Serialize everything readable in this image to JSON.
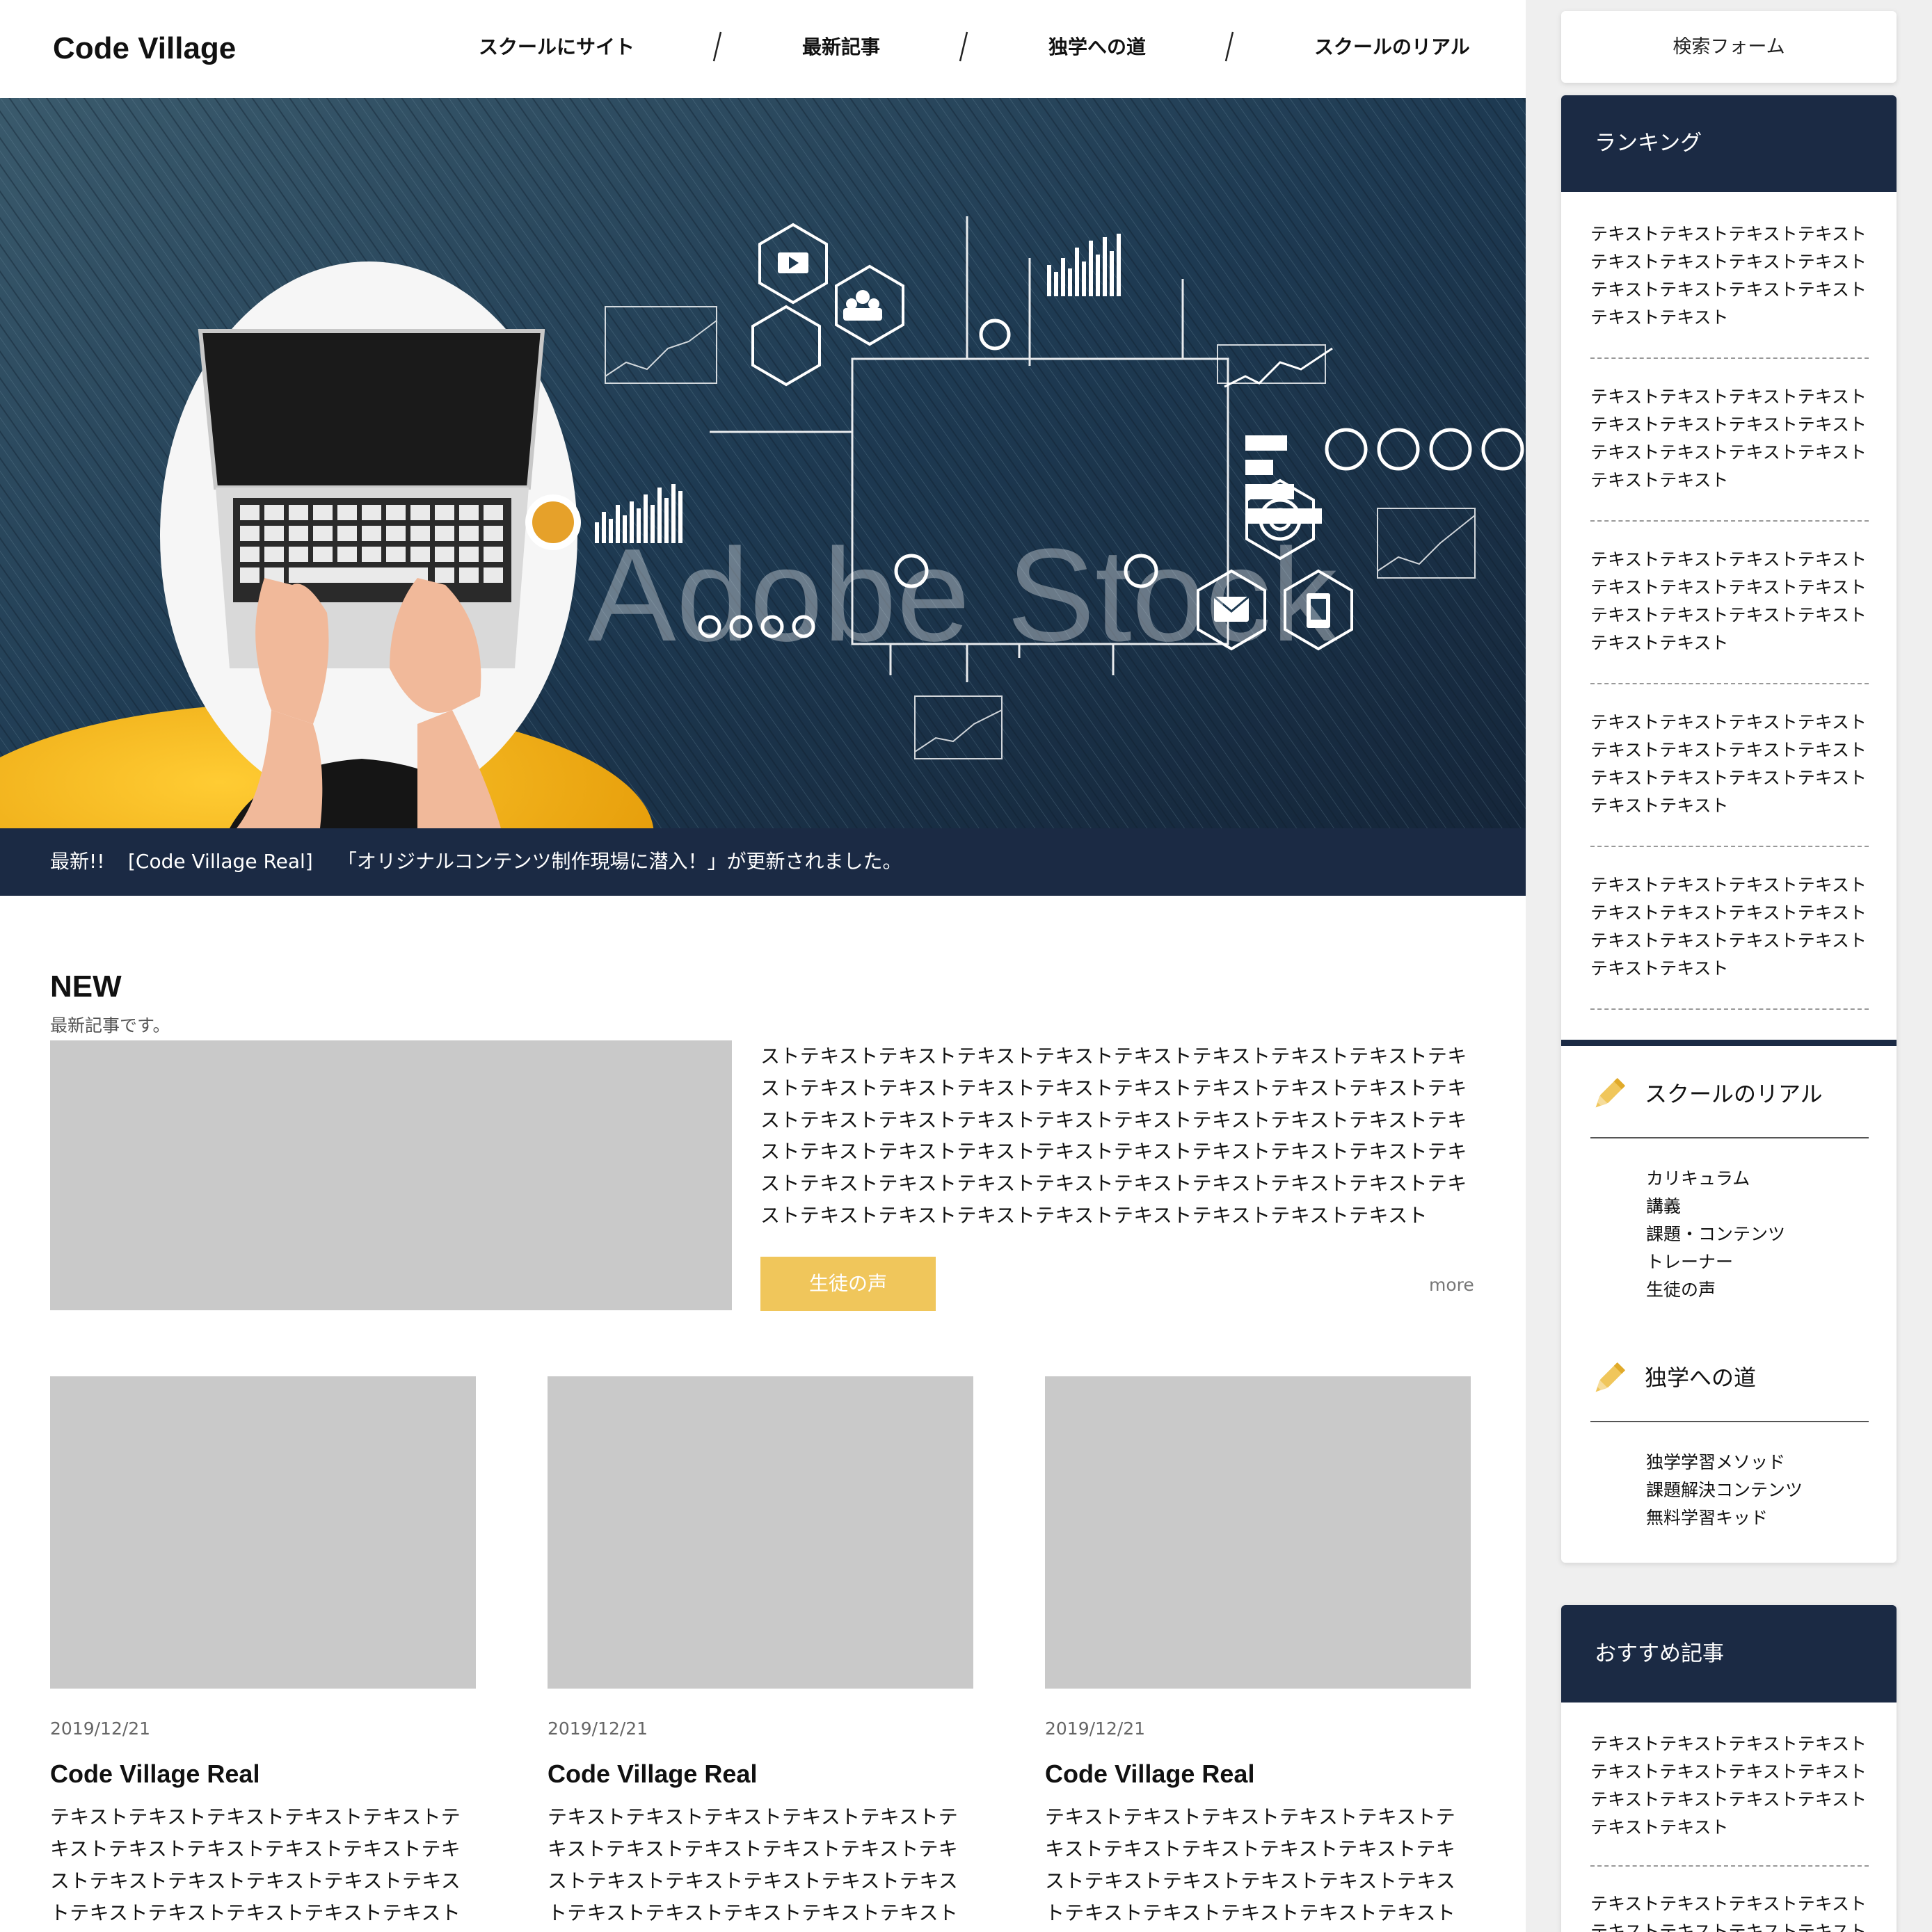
{
  "header": {
    "logo": "Code Village",
    "nav": [
      "スクールにサイト",
      "最新記事",
      "独学への道",
      "スクールのリアル"
    ]
  },
  "hero": {
    "watermark": "Adobe Stock"
  },
  "ticker": {
    "label": "最新!!",
    "tag": "[Code Village Real]",
    "message": "「オリジナルコンテンツ制作現場に潜入！」が更新されました。"
  },
  "new_section": {
    "title": "NEW",
    "subtitle": "最新記事です。",
    "text": "ストテキストテキストテキストテキストテキストテキストテキストテキストテキストテキストテキストテキストテキストテキストテキストテキストテキストテキストテキストテキストテキストテキストテキストテキストテキストテキストテキストテキストテキストテキストテキストテキストテキストテキストテキストテキストテキストテキストテキストテキストテキストテキストテキストテキストテキストテキストテキストテキストテキストテキストテキストテキストテキスト",
    "button": "生徒の声",
    "more": "more"
  },
  "cards": [
    {
      "date": "2019/12/21",
      "title": "Code Village Real",
      "text": "テキストテキストテキストテキストテキストテキストテキストテキストテキストテキストテキストテキストテキストテキストテキストテキストテキストテキストテキストテキストテキストテキストテキストテキスト"
    },
    {
      "date": "2019/12/21",
      "title": "Code Village Real",
      "text": "テキストテキストテキストテキストテキストテキストテキストテキストテキストテキストテキストテキストテキストテキストテキストテキストテキストテキストテキストテキストテキストテキストテキストテキスト"
    },
    {
      "date": "2019/12/21",
      "title": "Code Village Real",
      "text": "テキストテキストテキストテキストテキストテキストテキストテキストテキストテキストテキストテキストテキストテキストテキストテキストテキストテキストテキストテキストテキストテキストテキストテキスト"
    }
  ],
  "sidebar": {
    "search": "検索フォーム",
    "ranking_title": "ランキング",
    "ranking_items": [
      "テキストテキストテキストテキストテキストテキストテキストテキストテキストテキストテキストテキストテキストテキスト",
      "テキストテキストテキストテキストテキストテキストテキストテキストテキストテキストテキストテキストテキストテキスト",
      "テキストテキストテキストテキストテキストテキストテキストテキストテキストテキストテキストテキストテキストテキスト",
      "テキストテキストテキストテキストテキストテキストテキストテキストテキストテキストテキストテキストテキストテキスト",
      "テキストテキストテキストテキストテキストテキストテキストテキストテキストテキストテキストテキストテキストテキスト"
    ],
    "categories": [
      {
        "title": "スクールのリアル",
        "links": [
          "カリキュラム",
          "講義",
          "課題・コンテンツ",
          "トレーナー",
          "生徒の声"
        ]
      },
      {
        "title": "独学への道",
        "links": [
          "独学学習メソッド",
          "課題解決コンテンツ",
          "無料学習キッド"
        ]
      }
    ],
    "recommended_title": "おすすめ記事",
    "recommended_items": [
      "テキストテキストテキストテキストテキストテキストテキストテキストテキストテキストテキストテキストテキストテキスト",
      "テキストテキストテキストテキストテキストテキストテキストテキスト"
    ]
  },
  "colors": {
    "navy": "#1b2a44",
    "accent_yellow": "#f0c65b",
    "placeholder_gray": "#c9c9c9"
  }
}
